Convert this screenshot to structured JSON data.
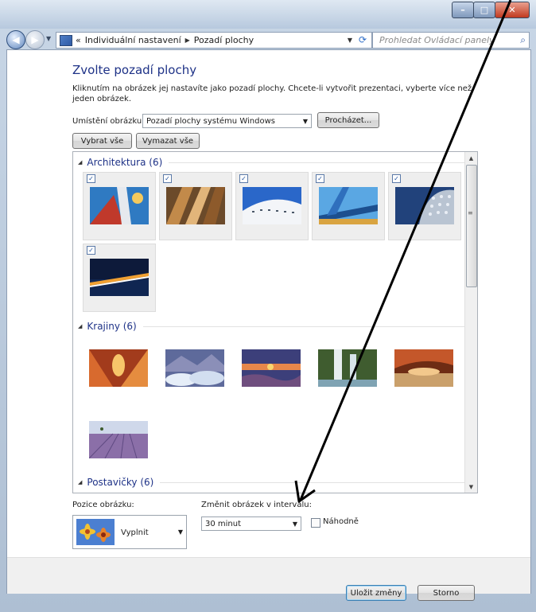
{
  "window": {
    "caption_min": "–",
    "caption_max": "□",
    "caption_close": "✕"
  },
  "nav": {
    "back_glyph": "◀",
    "forward_glyph": "▶",
    "address_prefix": "«",
    "breadcrumb": [
      "Individuální nastavení",
      "Pozadí plochy"
    ],
    "search_placeholder": "Prohledat Ovládací panely"
  },
  "page": {
    "title": "Zvolte pozadí plochy",
    "description": "Kliknutím na obrázek jej nastavíte jako pozadí plochy. Chcete-li vytvořit prezentaci, vyberte více než jeden obrázek.",
    "location_label": "Umístění obrázku:",
    "location_value": "Pozadí plochy systému Windows",
    "browse_label": "Procházet...",
    "select_all_label": "Vybrat vše",
    "clear_all_label": "Vymazat vše"
  },
  "groups": [
    {
      "name": "Architektura (6)"
    },
    {
      "name": "Krajiny (6)"
    },
    {
      "name": "Postavičky (6)"
    }
  ],
  "architecture_tiles": [
    {
      "checked": true,
      "icon": "architecture-red-tower"
    },
    {
      "checked": true,
      "icon": "architecture-bronze-panels"
    },
    {
      "checked": true,
      "icon": "architecture-white-curve"
    },
    {
      "checked": true,
      "icon": "architecture-blue-wing"
    },
    {
      "checked": true,
      "icon": "architecture-dotted-facade"
    },
    {
      "checked": true,
      "icon": "architecture-night-bridge"
    }
  ],
  "landscape_tiles": [
    {
      "checked": false,
      "icon": "landscape-red-canyon"
    },
    {
      "checked": false,
      "icon": "landscape-ice-lake"
    },
    {
      "checked": false,
      "icon": "landscape-sunset-shore"
    },
    {
      "checked": false,
      "icon": "landscape-waterfall"
    },
    {
      "checked": false,
      "icon": "landscape-rock-arch"
    },
    {
      "checked": false,
      "icon": "landscape-lavender-field"
    }
  ],
  "bottom": {
    "position_label": "Pozice obrázku:",
    "position_value": "Vyplnit",
    "interval_label": "Změnit obrázek v intervalu:",
    "interval_value": "30 minut",
    "shuffle_label": "Náhodně",
    "shuffle_checked": false,
    "save_label": "Uložit změny",
    "cancel_label": "Storno"
  },
  "colors": {
    "title_blue": "#1e3287",
    "selection_gray": "#eeeeee",
    "annotation_arrow": "#000000"
  }
}
